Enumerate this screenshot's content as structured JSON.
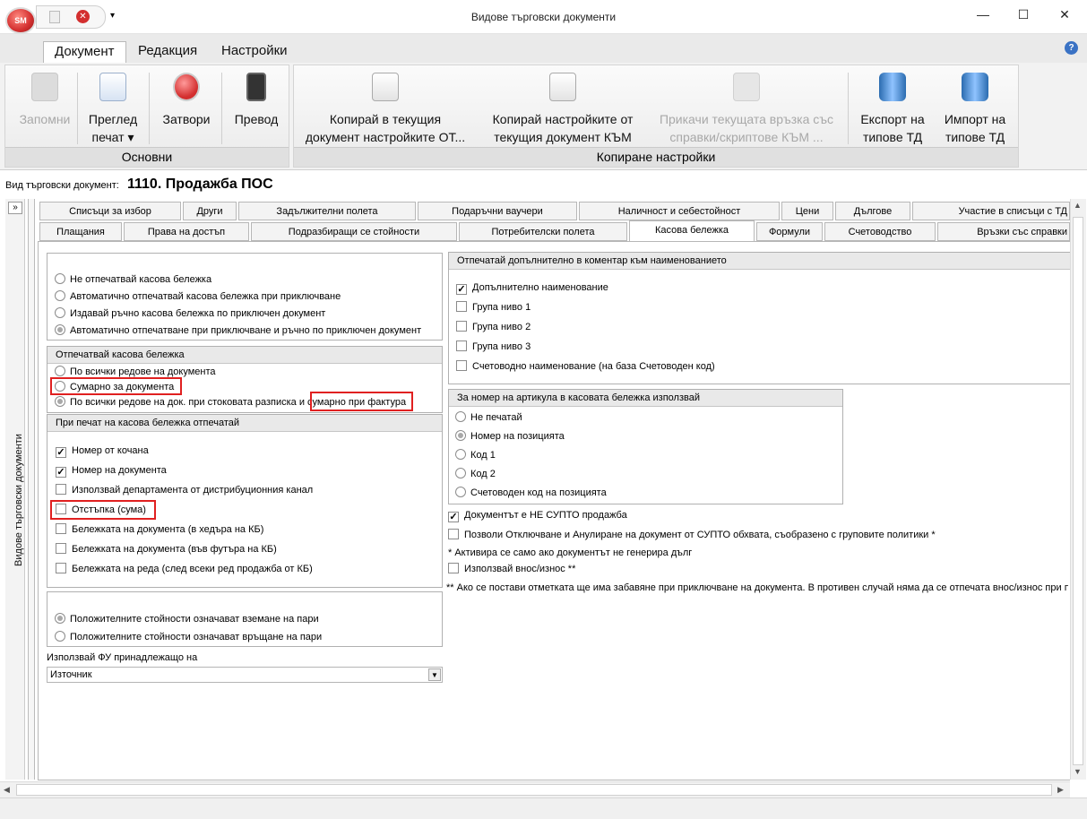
{
  "window": {
    "title": "Видове търговски документи",
    "minimize": "—",
    "maximize": "☐",
    "close": "✕",
    "orb": "SM"
  },
  "menu": {
    "tabs": [
      "Документ",
      "Редакция",
      "Настройки"
    ],
    "help": "?"
  },
  "ribbon": {
    "groups": [
      {
        "caption": "Основни",
        "buttons": [
          {
            "label": "Запомни",
            "label2": "",
            "disabled": true
          },
          {
            "label": "Преглед",
            "label2": "печат ▾",
            "disabled": false
          },
          {
            "label": "Затвори",
            "label2": "",
            "disabled": false
          },
          {
            "label": "Превод",
            "label2": "",
            "disabled": false
          }
        ]
      },
      {
        "caption": "Копиране настройки",
        "buttons": [
          {
            "label": "Копирай в текущия",
            "label2": "документ настройките ОТ...",
            "disabled": false
          },
          {
            "label": "Копирай настройките от",
            "label2": "текущия документ КЪМ",
            "disabled": false
          },
          {
            "label": "Прикачи текущата връзка със",
            "label2": "справки/скриптове КЪМ ...",
            "disabled": true
          },
          {
            "label": "Експорт на",
            "label2": "типове ТД",
            "disabled": false
          },
          {
            "label": "Импорт на",
            "label2": "типове ТД",
            "disabled": false
          }
        ]
      }
    ]
  },
  "doc": {
    "label": "Вид търговски документ:",
    "value": "1110. Продажба ПОС"
  },
  "sidepanel": {
    "label": "Видове търговски документи",
    "toggle": "»"
  },
  "tabs_row1": [
    "Списъци за избор",
    "Други",
    "Задължителни полета",
    "Подаръчни ваучери",
    "Наличност и себестойност",
    "Цени",
    "Дългове",
    "Участие в списъци с ТД"
  ],
  "tabs_row2": [
    "Плащания",
    "Права на достъп",
    "Подразбиращи се стойности",
    "Потребителски полета",
    "Касова бележка",
    "Формули",
    "Счетоводство",
    "Връзки със справки"
  ],
  "left": {
    "print_mode": [
      {
        "label": "Не отпечатвай касова бележка",
        "selected": false
      },
      {
        "label": "Автоматично отпечатвай касова бележка при приключване",
        "selected": false
      },
      {
        "label": "Издавай ръчно касова бележка по приключен документ",
        "selected": false
      },
      {
        "label": "Автоматично отпечатване при приключване и ръчно по приключен документ",
        "selected": true
      }
    ],
    "receipt_header": "Отпечатвай касова бележка",
    "receipt_mode": [
      {
        "label": "По всички редове на документа",
        "selected": false
      },
      {
        "label": "Сумарно за документа",
        "selected": false
      },
      {
        "label": "По всички редове на док. при стоковата разписка и",
        "label2": "сумарно при фактура",
        "selected": true
      }
    ],
    "print_header": "При печат на касова бележка отпечатай",
    "print_items": [
      {
        "label": "Номер от кочана",
        "checked": true
      },
      {
        "label": "Номер на документа",
        "checked": true
      },
      {
        "label": "Използвай департамента от дистрибуционния канал",
        "checked": false
      },
      {
        "label": "Отстъпка (сума)",
        "checked": false
      },
      {
        "label": "Бележката на документа (в хедъра на КБ)",
        "checked": false
      },
      {
        "label": "Бележката на документа (във футъра на КБ)",
        "checked": false
      },
      {
        "label": "Бележката на реда (след всеки ред продажба от КБ)",
        "checked": false
      }
    ],
    "values_mode": [
      {
        "label": "Положителните стойности означават вземане на пари",
        "selected": true
      },
      {
        "label": "Положителните стойности означават връщане на пари",
        "selected": false
      }
    ],
    "fu_label": "Използвай ФУ принадлежащо на",
    "fu_value": "Източник"
  },
  "right": {
    "extra_header": "Отпечатай допълнително в коментар към наименованието",
    "extra_items": [
      {
        "label": "Допълнително наименование",
        "checked": true
      },
      {
        "label": "Група ниво 1",
        "checked": false
      },
      {
        "label": "Група ниво 2",
        "checked": false
      },
      {
        "label": "Група ниво 3",
        "checked": false
      },
      {
        "label": "Счетоводно наименование (на база Счетоводен код)",
        "checked": false
      }
    ],
    "article_header": "За номер на артикула в касовата бележка използвай",
    "article_items": [
      {
        "label": "Не печатай",
        "selected": false
      },
      {
        "label": "Номер на позицията",
        "selected": true
      },
      {
        "label": "Код 1",
        "selected": false
      },
      {
        "label": "Код 2",
        "selected": false
      },
      {
        "label": "Счетоводен код на позицията",
        "selected": false
      }
    ],
    "not_supto": {
      "label": "Документът е НЕ СУПТО продажба",
      "checked": true
    },
    "allow_unlock": {
      "label": "Позволи Отключване и Анулиране на документ от СУПТО обхвата, съобразено с груповите политики *",
      "checked": false
    },
    "note1": "* Активира се само ако документът не генерира дълг",
    "in_out": {
      "label": "Използвай внос/износ **",
      "checked": false
    },
    "note2": "** Ако се постави отметката ще има забавяне при приключване на документа. В противен случай няма да се отпечата внос/износ при приключване"
  },
  "scroll": {
    "up": "▲",
    "down": "▼",
    "left": "◀",
    "right": "▶"
  },
  "colors": {
    "highlight": "#e02020",
    "accent_red": "#d32f2f"
  }
}
